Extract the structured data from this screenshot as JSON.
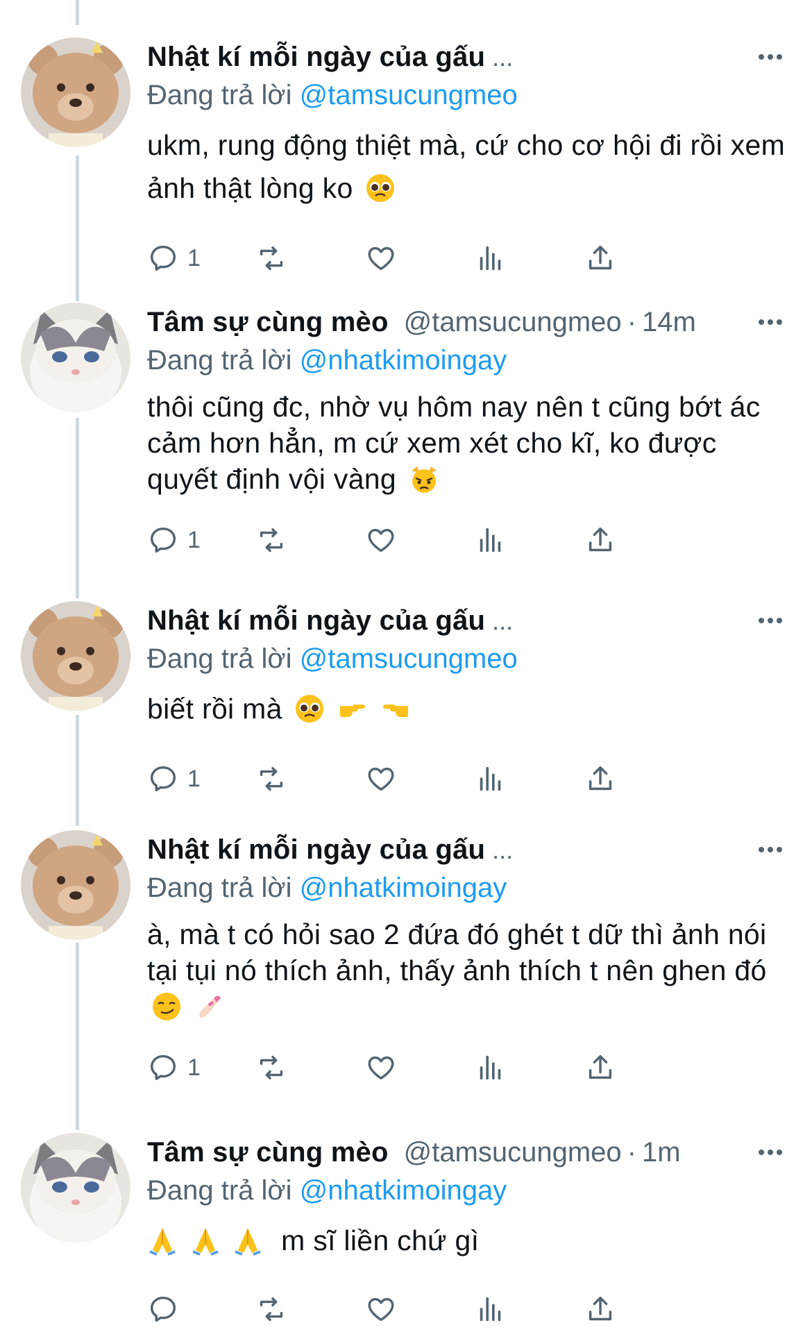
{
  "colors": {
    "link": "#1d9bf0",
    "secondary": "#536471",
    "thread_line": "#cfd9de"
  },
  "tweets": [
    {
      "author_name": "Nhật kí mỗi ngày của gấu",
      "name_ellipsis": "...",
      "handle": "",
      "time": "",
      "reply_prefix": "Đang trả lời",
      "reply_to": "@tamsucungmeo",
      "text": "ukm, rung động thiệt mà, cứ cho cơ hội đi rồi xem ảnh thật lòng ko",
      "emojis": [
        "pleading-face"
      ],
      "reply_count": "1",
      "avatar": "teddy-bear-avatar"
    },
    {
      "author_name": "Tâm sự cùng mèo",
      "name_ellipsis": "",
      "handle": "@tamsucungmeo",
      "time": "14m",
      "reply_prefix": "Đang trả lời",
      "reply_to": "@nhatkimoingay",
      "text": "thôi cũng đc, nhờ vụ hôm nay nên t cũng bớt ác cảm hơn hẳn, m cứ xem xét cho kĩ, ko được quyết định vội vàng",
      "emojis": [
        "pouting-cat"
      ],
      "reply_count": "1",
      "avatar": "white-cat-avatar"
    },
    {
      "author_name": "Nhật kí mỗi ngày của gấu",
      "name_ellipsis": "...",
      "handle": "",
      "time": "",
      "reply_prefix": "Đang trả lời",
      "reply_to": "@tamsucungmeo",
      "text": "biết rồi mà",
      "emojis": [
        "pleading-face",
        "pointing-right",
        "pointing-left"
      ],
      "reply_count": "1",
      "avatar": "teddy-bear-avatar"
    },
    {
      "author_name": "Nhật kí mỗi ngày của gấu",
      "name_ellipsis": "...",
      "handle": "",
      "time": "",
      "reply_prefix": "Đang trả lời",
      "reply_to": "@nhatkimoingay",
      "text": "à, mà t có hỏi sao 2 đứa đó ghét t dữ thì ảnh nói tại tụi nó thích ảnh, thấy ảnh thích t nên ghen đó",
      "emojis": [
        "smirking-face",
        "nail-polish"
      ],
      "reply_count": "1",
      "avatar": "teddy-bear-avatar"
    },
    {
      "author_name": "Tâm sự cùng mèo",
      "name_ellipsis": "",
      "handle": "@tamsucungmeo",
      "time": "1m",
      "reply_prefix": "Đang trả lời",
      "reply_to": "@nhatkimoingay",
      "text": "m sĩ liền chứ gì",
      "emojis_before": [
        "folded-hands",
        "folded-hands",
        "folded-hands"
      ],
      "emojis": [],
      "reply_count": "",
      "avatar": "white-cat-avatar"
    }
  ],
  "time_separator": "·"
}
